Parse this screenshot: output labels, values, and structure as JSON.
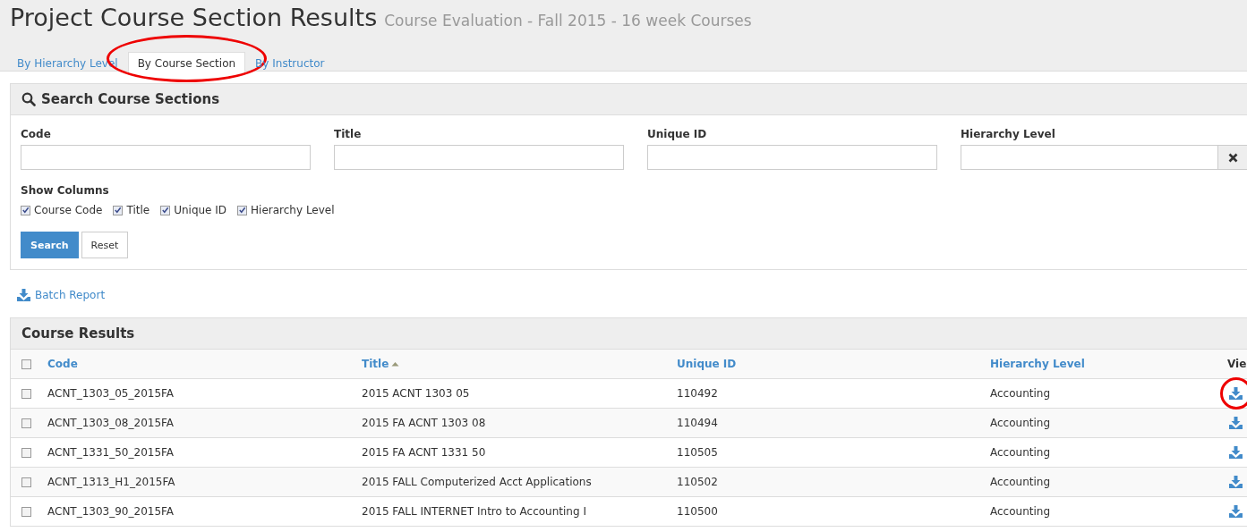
{
  "page": {
    "title": "Project Course Section Results",
    "subtitle": "Course Evaluation - Fall 2015 - 16 week Courses"
  },
  "tabs": [
    {
      "label": "By Hierarchy Level",
      "selected": false,
      "circled": false
    },
    {
      "label": "By Course Section",
      "selected": true,
      "circled": true
    },
    {
      "label": "By Instructor",
      "selected": false,
      "circled": false
    }
  ],
  "search_panel": {
    "title": "Search Course Sections",
    "fields": [
      {
        "label": "Code",
        "kind": "text"
      },
      {
        "label": "Title",
        "kind": "text"
      },
      {
        "label": "Unique ID",
        "kind": "text"
      },
      {
        "label": "Hierarchy Level",
        "kind": "clearable"
      }
    ],
    "show_columns_label": "Show Columns",
    "columns": [
      {
        "label": "Course Code",
        "checked": true
      },
      {
        "label": "Title",
        "checked": true
      },
      {
        "label": "Unique ID",
        "checked": true
      },
      {
        "label": "Hierarchy Level",
        "checked": true
      }
    ],
    "buttons": [
      {
        "label": "Search",
        "kind": "primary"
      },
      {
        "label": "Reset",
        "kind": "default"
      }
    ]
  },
  "batch_report": "Batch Report",
  "results": {
    "title": "Course Results",
    "select_all_checked": false,
    "columns": [
      {
        "label": "Code"
      },
      {
        "label": "Title",
        "sorted": true
      },
      {
        "label": "Unique ID"
      },
      {
        "label": "Hierarchy Level"
      },
      {
        "label": "Vie"
      }
    ],
    "rows": [
      {
        "checked": false,
        "code": "ACNT_1303_05_2015FA",
        "title": "2015 ACNT 1303 05",
        "unique_id": "110492",
        "hierarchy": "Accounting",
        "view_circled": true
      },
      {
        "checked": false,
        "code": "ACNT_1303_08_2015FA",
        "title": "2015 FA ACNT 1303 08",
        "unique_id": "110494",
        "hierarchy": "Accounting"
      },
      {
        "checked": false,
        "code": "ACNT_1331_50_2015FA",
        "title": "2015 FA ACNT 1331 50",
        "unique_id": "110505",
        "hierarchy": "Accounting"
      },
      {
        "checked": false,
        "code": "ACNT_1313_H1_2015FA",
        "title": "2015 FALL Computerized Acct Applications",
        "unique_id": "110502",
        "hierarchy": "Accounting"
      },
      {
        "checked": false,
        "code": "ACNT_1303_90_2015FA",
        "title": "2015 FALL INTERNET Intro to Accounting I",
        "unique_id": "110500",
        "hierarchy": "Accounting"
      }
    ]
  }
}
